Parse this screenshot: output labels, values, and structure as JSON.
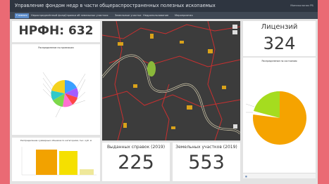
{
  "app": {
    "title": "Управление фондом недр в части общераспространенных полезных ископаемых",
    "user": "Минэкологии РБ"
  },
  "tabs": [
    {
      "label": "Главная"
    },
    {
      "label": "Нераспределённый фонд"
    },
    {
      "label": "Справки об земельных участках"
    },
    {
      "label": "Земельные участки"
    },
    {
      "label": "Недропользование"
    },
    {
      "label": "Мероприятия"
    }
  ],
  "nrfn": {
    "label": "НРФН: 632"
  },
  "licenses": {
    "label": "Лицензий",
    "value": "324"
  },
  "certificates": {
    "label": "Выданных справок (2019)",
    "value": "225"
  },
  "plots": {
    "label": "Земельных участков (2019)",
    "value": "553"
  },
  "pie_left": {
    "title": "Распределение по признакам",
    "colors": [
      "#f4d21f",
      "#3aa0ff",
      "#7cd84a",
      "#ff6fd0",
      "#ff4545",
      "#a45cff",
      "#2ec9c9",
      "#ffa020"
    ]
  },
  "pie_right": {
    "title": "Распределение по состоянию",
    "colors": [
      "#f5a300",
      "#a5dc1f",
      "#ffffff"
    ]
  },
  "bar_panel": {
    "title": "Распределение суммарных объемов по категориям, тыс. куб. м",
    "colors": [
      "#f2a200",
      "#f5e000",
      "#efe89a"
    ]
  },
  "map": {
    "background": "#3c3c3c",
    "road_color": "#c93030",
    "water_color": "#b0aa90"
  }
}
